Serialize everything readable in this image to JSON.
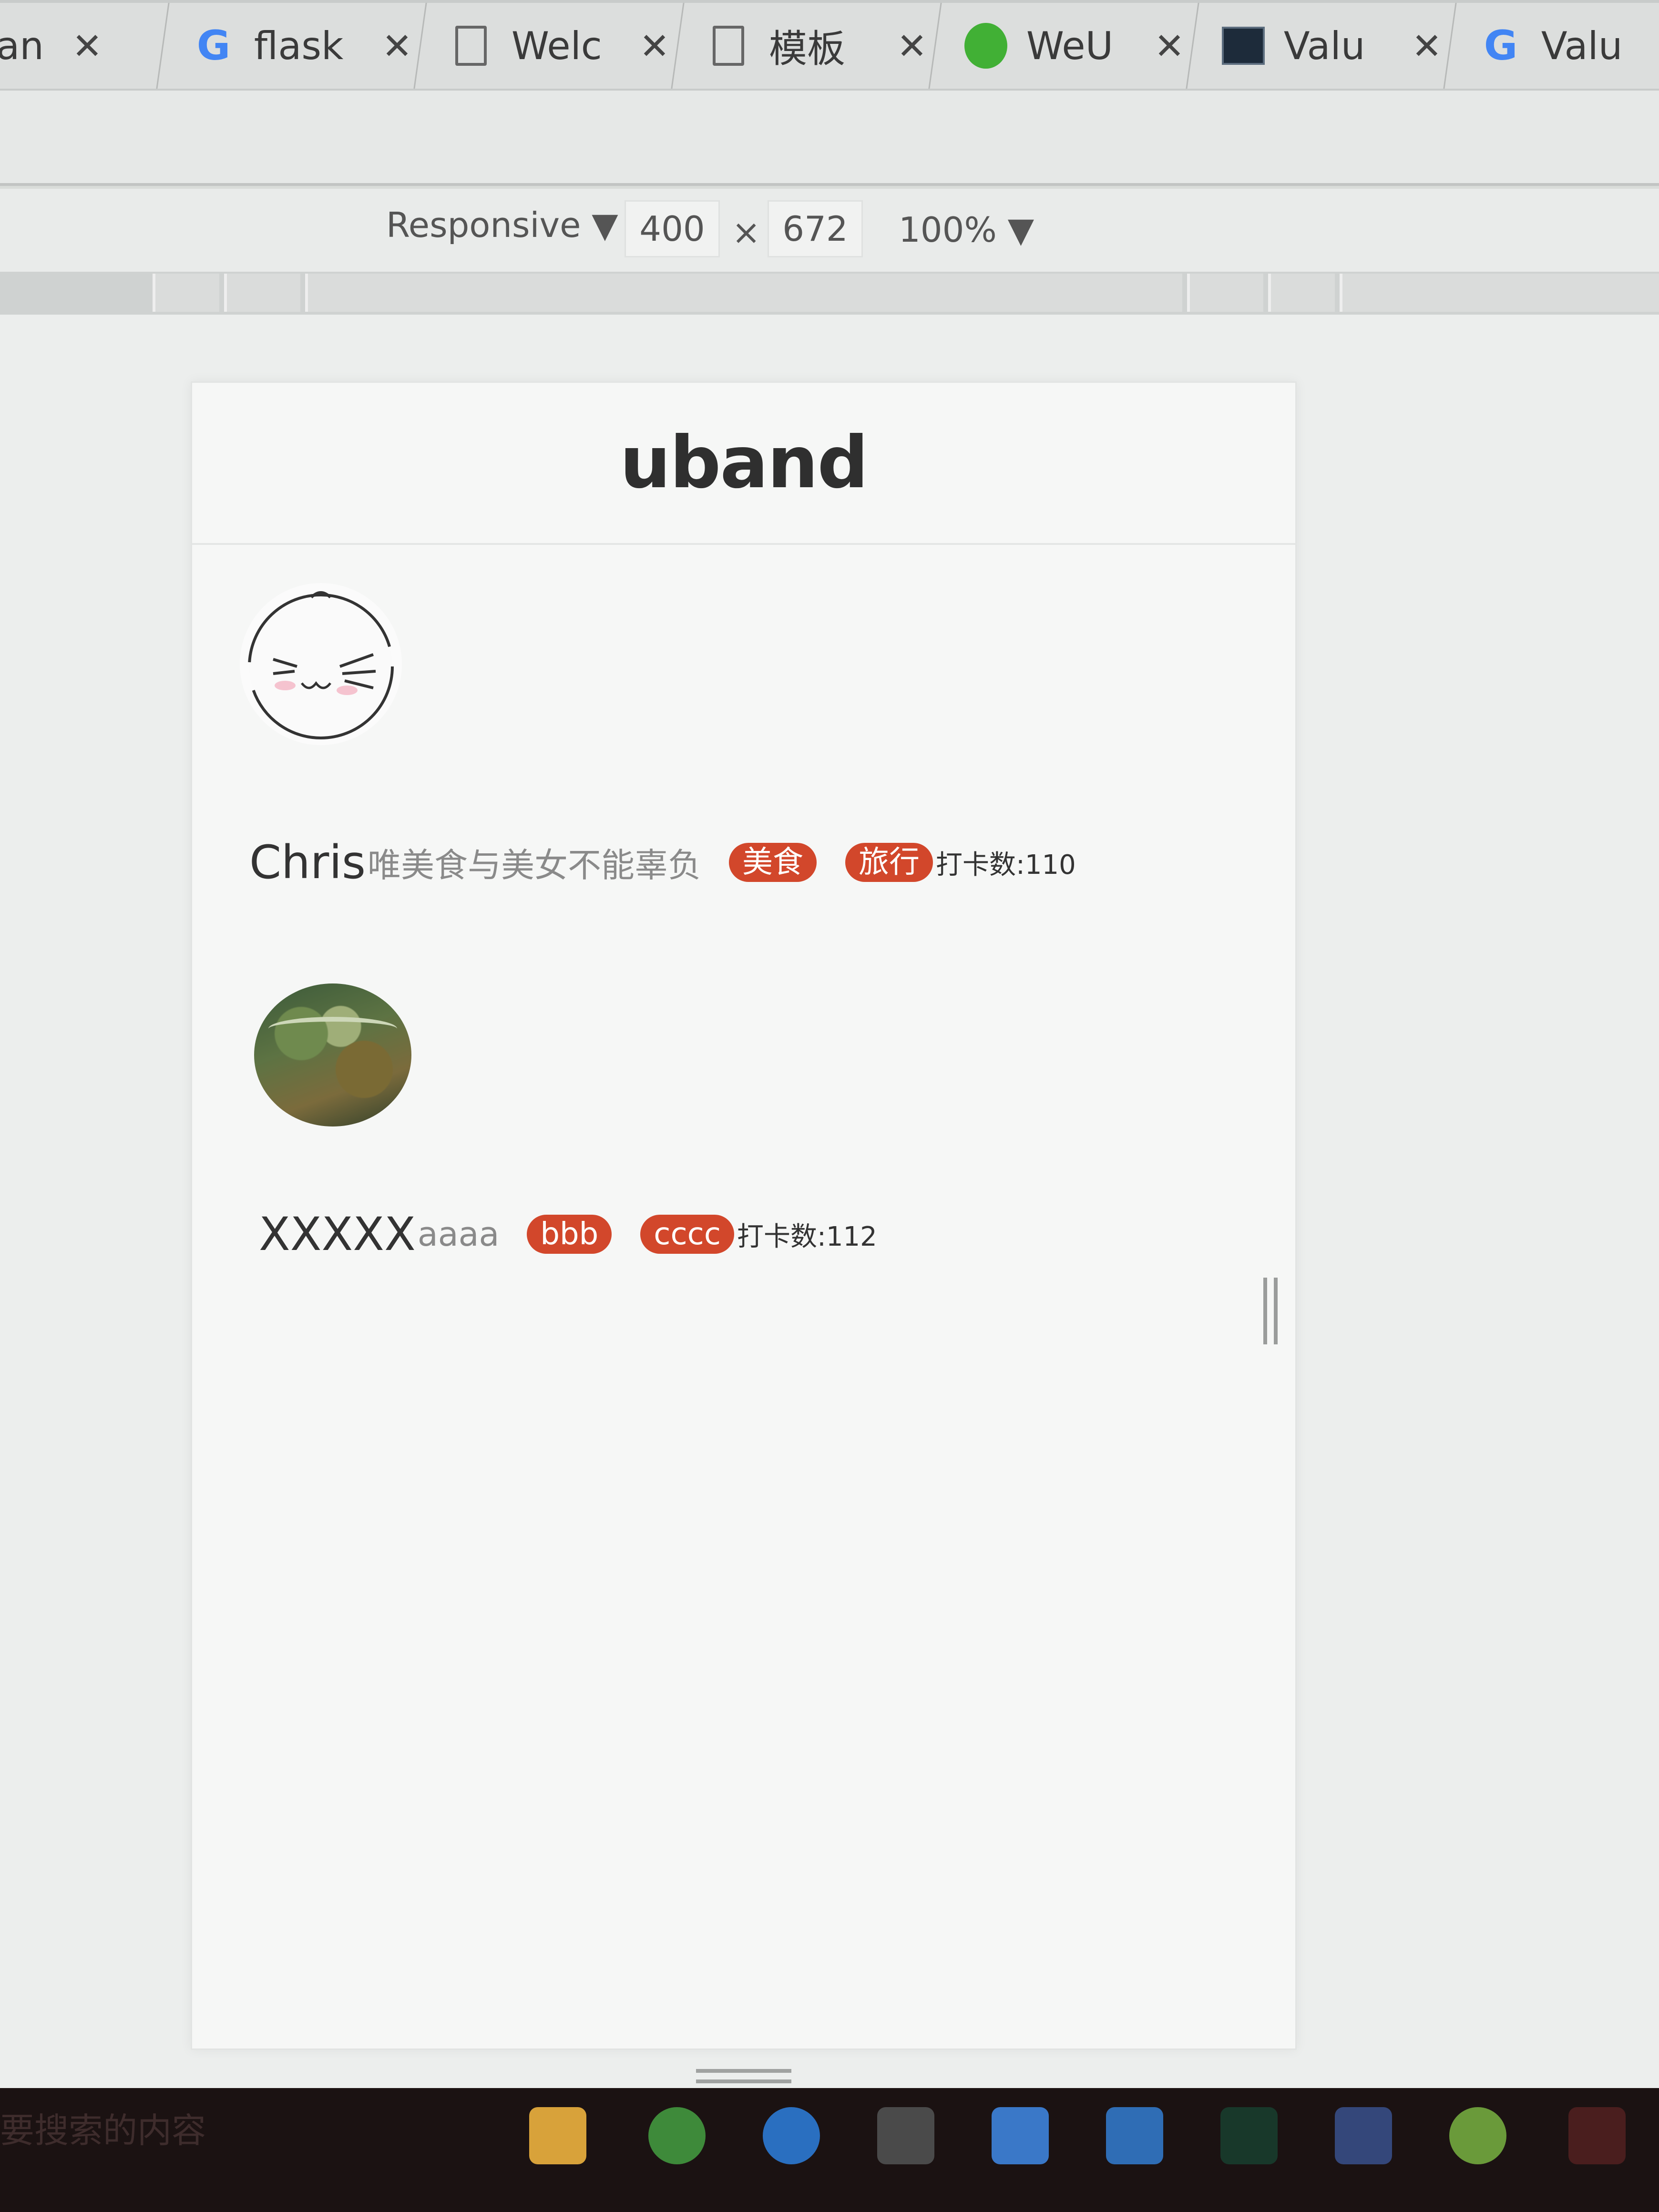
{
  "browser": {
    "tabs": [
      {
        "label": "Uban",
        "icon": "document-icon"
      },
      {
        "label": "flask",
        "icon": "google-icon"
      },
      {
        "label": "Welc",
        "icon": "document-icon"
      },
      {
        "label": "模板",
        "icon": "document-icon"
      },
      {
        "label": "WeU",
        "icon": "wechat-icon"
      },
      {
        "label": "Valu",
        "icon": "terminal-icon"
      },
      {
        "label": "Valu",
        "icon": "google-icon"
      }
    ],
    "close_glyph": "✕"
  },
  "device_toolbar": {
    "mode": "Responsive ▼",
    "width": "400",
    "times": "×",
    "height": "672",
    "zoom": "100% ▼"
  },
  "page": {
    "logo": "uband",
    "users": [
      {
        "name": "Chris",
        "signature": "唯美食与美女不能辜负",
        "tags": [
          "美食",
          "旅行"
        ],
        "checkin": "打卡数:110"
      },
      {
        "name": "XXXXX",
        "signature": "aaaa",
        "tags": [
          "bbb",
          "cccc"
        ],
        "checkin": "打卡数:112"
      }
    ],
    "tag_color": "#d2472b"
  },
  "taskbar": {
    "search_text": "要搜索的内容"
  }
}
